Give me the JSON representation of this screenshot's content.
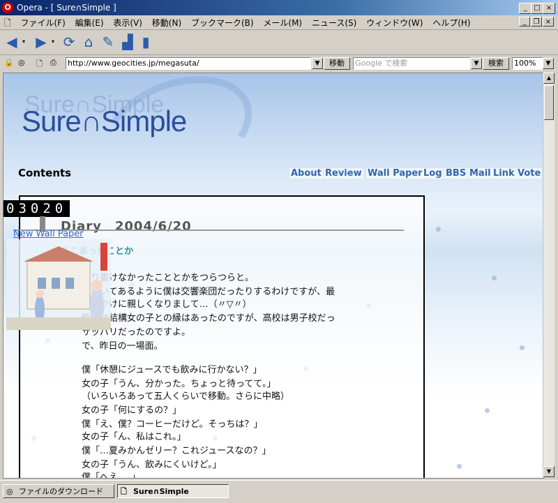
{
  "window": {
    "title": "Opera - [ Sure∩Simple ]",
    "app_icon": "opera-icon",
    "buttons": [
      "_",
      "□",
      "×"
    ]
  },
  "menubar": {
    "items": [
      "ファイル(F)",
      "編集(E)",
      "表示(V)",
      "移動(N)",
      "ブックマーク(B)",
      "メール(M)",
      "ニュース(S)",
      "ウィンドウ(W)",
      "ヘルプ(H)"
    ]
  },
  "toolbar": {
    "icons": [
      "back-icon",
      "forward-icon",
      "reload-icon",
      "home-icon",
      "hotlist-icon",
      "print-icon",
      "page-icon"
    ]
  },
  "addressbar": {
    "url": "http://www.geocities.jp/megasuta/",
    "go_label": "移動",
    "search_placeholder": "Google で検索",
    "search_label": "検索",
    "zoom": "100%"
  },
  "page": {
    "logo_text": "Sure∩Simple",
    "logo_shadow": "Sure∩Simple",
    "contents_label": "Contents",
    "nav": [
      "About",
      "Review",
      "Wall Paper",
      "Log",
      "BBS",
      "Mail",
      "Link",
      "Vote"
    ],
    "counter": "03020",
    "diary_title": "Diary　2004/6/20",
    "new_wallpaper_link": "New Wall Paper",
    "entry_title": "ここあったことか",
    "body": [
      "まり書けなかったこととかをつらつらと。",
      "で書いてあるように僕は交響楽団だったりするわけですが、最",
      "子とやけに親しくなりまして…（〃▽〃）",
      "時代は結構女の子との縁はあったのですが、高校は男子校だっ",
      "サッパリだったのですよ。",
      "で、昨日の一場面。",
      "",
      "僕「休憩にジュースでも飲みに行かない？」",
      "女の子「うん、分かった。ちょっと待ってて。」",
      "（いろいろあって五人くらいで移動。さらに中略）",
      "女の子「何にするの？」",
      "僕「え、僕？コーヒーだけど。そっちは？」",
      "女の子「ん、私はこれ。」",
      "僕「…夏みかんゼリー？これジュースなの？」",
      "女の子「うん、飲みにくいけど。」",
      "僕「へえ…。」"
    ]
  },
  "statusbar": {
    "tabs": [
      "ファイルのダウンロード",
      "Sure∩Simple"
    ]
  }
}
